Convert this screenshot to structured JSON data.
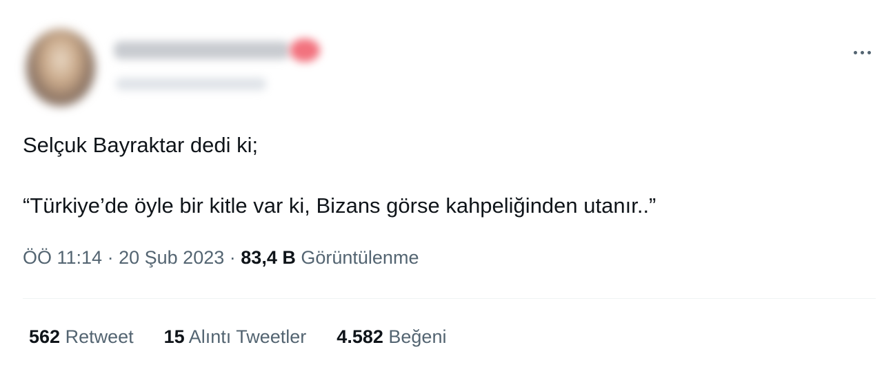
{
  "tweet": {
    "lines": [
      "Selçuk Bayraktar dedi ki;",
      "“Türkiye’de öyle bir kitle var ki, Bizans görse kahpeliğinden utanır..”"
    ],
    "time": "ÖÖ 11:14",
    "date": "20 Şub 2023",
    "separator": "·",
    "views_count": "83,4 B",
    "views_label": "Görüntülenme"
  },
  "stats": [
    {
      "count": "562",
      "label": "Retweet"
    },
    {
      "count": "15",
      "label": "Alıntı Tweetler"
    },
    {
      "count": "4.582",
      "label": "Beğeni"
    }
  ],
  "icons": {
    "more": "more-horizontal-icon"
  },
  "colors": {
    "text_primary": "#0f1419",
    "text_secondary": "#536471",
    "divider": "#eff3f4"
  }
}
